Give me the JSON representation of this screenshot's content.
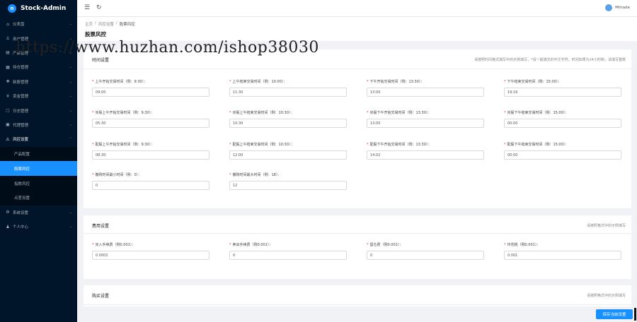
{
  "app": {
    "name": "Stock-Admin",
    "logo_char": "n"
  },
  "sidebar": {
    "items": [
      {
        "label": "仪表盘",
        "icon": "⌂"
      },
      {
        "label": "用户管理",
        "icon": "♙"
      },
      {
        "label": "产品管理",
        "icon": "▤"
      },
      {
        "label": "持仓管理",
        "icon": "▦"
      },
      {
        "label": "新股管理",
        "icon": "✚"
      },
      {
        "label": "资金管理",
        "icon": "¥"
      },
      {
        "label": "日志管理",
        "icon": "▢"
      },
      {
        "label": "代理管理",
        "icon": "▣"
      }
    ],
    "open_group": {
      "label": "风控设置",
      "icon": "⚠"
    },
    "sub_items": [
      {
        "label": "产品配置"
      },
      {
        "label": "股票风控"
      },
      {
        "label": "指数风控"
      },
      {
        "label": "点差设置"
      }
    ],
    "bottom_items": [
      {
        "label": "系统设置",
        "icon": "⚙"
      },
      {
        "label": "个人中心",
        "icon": "♟"
      }
    ]
  },
  "header": {
    "user_name": "Mitrade"
  },
  "breadcrumb": [
    "主页",
    "/",
    "风控设置",
    "/",
    "股票风控"
  ],
  "page_title": "股票风控",
  "time_card": {
    "title": "时间设置",
    "tip": "请按照时间格式填写中的示例填写，*请一般填交的中文字符，时间如果为24小时制，请填写整数",
    "fields": [
      {
        "label": "上午开始交易时间（例：9:30）：",
        "value": "09:00"
      },
      {
        "label": "上午结束交易时间（例：10:00）：",
        "value": "11:30"
      },
      {
        "label": "下午开始交易时间（例：13:30）：",
        "value": "13:00"
      },
      {
        "label": "下午结束交易时间（例：15:00）：",
        "value": "19:16"
      },
      {
        "label": "买股上午开始交易时间（例：9:30）：",
        "value": "05:30"
      },
      {
        "label": "买股上午结束交易时间（例：10:30）：",
        "value": "10:30"
      },
      {
        "label": "买股下午开始交易时间（例：13:30）：",
        "value": "13:00"
      },
      {
        "label": "买股下午结束交易时间（例：15:00）：",
        "value": "00:00"
      },
      {
        "label": "配股上午开始交易时间（例：9:30）：",
        "value": "08:30"
      },
      {
        "label": "配股上午结束交易时间（例：10:30）：",
        "value": "12:00"
      },
      {
        "label": "配股下午开始交易时间（例：13:30）：",
        "value": "14:02"
      },
      {
        "label": "配股下午结束交易时间（例：15:00）：",
        "value": "00:00"
      },
      {
        "label": "撤购时间最小时间（例：0）：",
        "value": "0"
      },
      {
        "label": "撤购时间最大时间（例：18）：",
        "value": "12"
      }
    ]
  },
  "fee_card": {
    "title": "费用设置",
    "tip": "请按照格式中的示例填写",
    "fields": [
      {
        "label": "买入手续费（例0.001）：",
        "value": "0.0002"
      },
      {
        "label": "卖出手续费（例0.001）：",
        "value": "0"
      },
      {
        "label": "留仓费（例0.001）：",
        "value": "0"
      },
      {
        "label": "印花税（例0.001）：",
        "value": "0.001"
      }
    ]
  },
  "buy_card": {
    "title": "购买设置",
    "tip": "请按照格式中的示例填写"
  },
  "save_button": "保存当前设置",
  "watermark": "https://www.huzhan.com/ishop38030"
}
